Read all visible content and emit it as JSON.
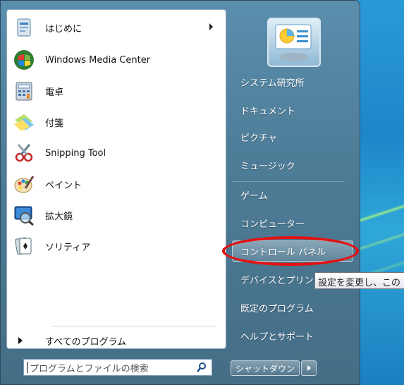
{
  "left_pane": {
    "programs": [
      {
        "label": "はじめに",
        "icon": "getting-started-icon",
        "has_submenu": true
      },
      {
        "label": "Windows Media Center",
        "icon": "media-center-icon",
        "has_submenu": false
      },
      {
        "label": "電卓",
        "icon": "calculator-icon",
        "has_submenu": false
      },
      {
        "label": "付箋",
        "icon": "sticky-notes-icon",
        "has_submenu": false
      },
      {
        "label": "Snipping Tool",
        "icon": "snipping-tool-icon",
        "has_submenu": false
      },
      {
        "label": "ペイント",
        "icon": "paint-icon",
        "has_submenu": false
      },
      {
        "label": "拡大鏡",
        "icon": "magnifier-icon",
        "has_submenu": false
      },
      {
        "label": "ソリティア",
        "icon": "solitaire-icon",
        "has_submenu": false
      }
    ],
    "all_programs_label": "すべてのプログラム",
    "search_placeholder": "プログラムとファイルの検索"
  },
  "right_pane": {
    "items": [
      {
        "label": "システム研究所"
      },
      {
        "label": "ドキュメント"
      },
      {
        "label": "ピクチャ"
      },
      {
        "label": "ミュージック"
      },
      {
        "label": "ゲーム"
      },
      {
        "label": "コンピューター"
      },
      {
        "label": "コントロール パネル",
        "highlighted": true
      },
      {
        "label": "デバイスとプリン"
      },
      {
        "label": "既定のプログラム"
      },
      {
        "label": "ヘルプとサポート"
      }
    ],
    "shutdown_label": "シャットダウン"
  },
  "tooltip": {
    "text": "設定を変更し、この"
  },
  "colors": {
    "annotation_ellipse": "#e31313",
    "menu_frame": "#4e7d98"
  }
}
